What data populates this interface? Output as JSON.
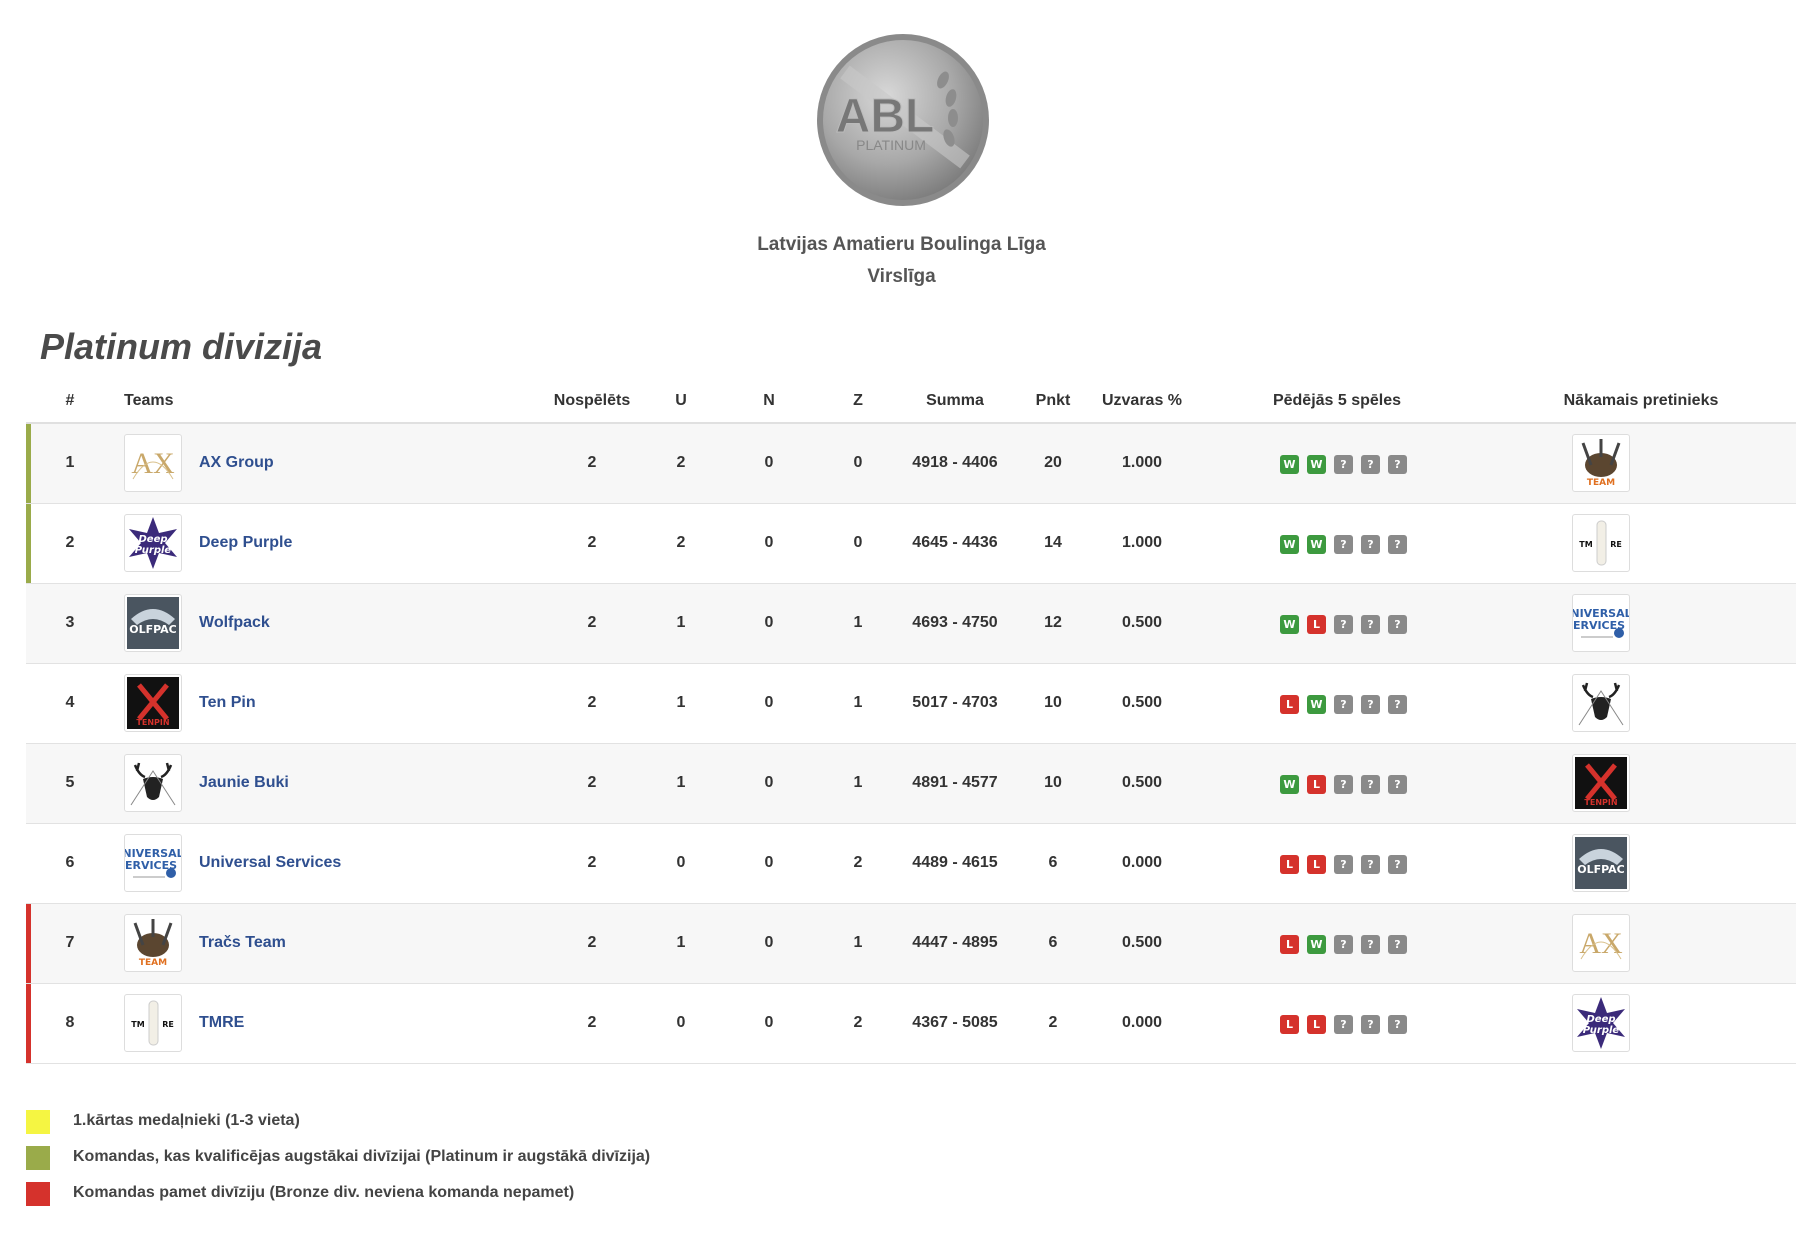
{
  "header": {
    "logo_text": "ABL",
    "logo_subtext": "PLATINUM",
    "league_name": "Latvijas Amatieru Boulinga Līga",
    "league_sub": "Virslīga"
  },
  "section_title": "Platinum divizija",
  "columns": {
    "rank": "#",
    "teams": "Teams",
    "played": "Nospēlēts",
    "wins": "U",
    "draws": "N",
    "losses": "Z",
    "total": "Summa",
    "points": "Pnkt",
    "win_pct": "Uzvaras %",
    "last5": "Pēdējās 5 spēles",
    "next": "Nākamais pretinieks"
  },
  "rows": [
    {
      "rank": "1",
      "team": "AX Group",
      "played": "2",
      "wins": "2",
      "draws": "0",
      "losses": "0",
      "total": "4918 - 4406",
      "points": "20",
      "pct": "1.000",
      "form": [
        "W",
        "W",
        "?",
        "?",
        "?"
      ],
      "logo": "ax-logo",
      "next": "tracs-logo",
      "marker": "#9aab4a"
    },
    {
      "rank": "2",
      "team": "Deep Purple",
      "played": "2",
      "wins": "2",
      "draws": "0",
      "losses": "0",
      "total": "4645 - 4436",
      "points": "14",
      "pct": "1.000",
      "form": [
        "W",
        "W",
        "?",
        "?",
        "?"
      ],
      "logo": "deep-purple-logo",
      "next": "tmre-logo",
      "marker": "#9aab4a"
    },
    {
      "rank": "3",
      "team": "Wolfpack",
      "played": "2",
      "wins": "1",
      "draws": "0",
      "losses": "1",
      "total": "4693 - 4750",
      "points": "12",
      "pct": "0.500",
      "form": [
        "W",
        "L",
        "?",
        "?",
        "?"
      ],
      "logo": "wolfpack-logo",
      "next": "universal-logo",
      "marker": ""
    },
    {
      "rank": "4",
      "team": "Ten Pin",
      "played": "2",
      "wins": "1",
      "draws": "0",
      "losses": "1",
      "total": "5017 - 4703",
      "points": "10",
      "pct": "0.500",
      "form": [
        "L",
        "W",
        "?",
        "?",
        "?"
      ],
      "logo": "tenpin-logo",
      "next": "buki-logo",
      "marker": ""
    },
    {
      "rank": "5",
      "team": "Jaunie Buki",
      "played": "2",
      "wins": "1",
      "draws": "0",
      "losses": "1",
      "total": "4891 - 4577",
      "points": "10",
      "pct": "0.500",
      "form": [
        "W",
        "L",
        "?",
        "?",
        "?"
      ],
      "logo": "buki-logo",
      "next": "tenpin-logo",
      "marker": ""
    },
    {
      "rank": "6",
      "team": "Universal Services",
      "played": "2",
      "wins": "0",
      "draws": "0",
      "losses": "2",
      "total": "4489 - 4615",
      "points": "6",
      "pct": "0.000",
      "form": [
        "L",
        "L",
        "?",
        "?",
        "?"
      ],
      "logo": "universal-logo",
      "next": "wolfpack-logo",
      "marker": ""
    },
    {
      "rank": "7",
      "team": "Tračs Team",
      "played": "2",
      "wins": "1",
      "draws": "0",
      "losses": "1",
      "total": "4447 - 4895",
      "points": "6",
      "pct": "0.500",
      "form": [
        "L",
        "W",
        "?",
        "?",
        "?"
      ],
      "logo": "tracs-logo",
      "next": "ax-logo",
      "marker": "#d5322c"
    },
    {
      "rank": "8",
      "team": "TMRE",
      "played": "2",
      "wins": "0",
      "draws": "0",
      "losses": "2",
      "total": "4367 - 5085",
      "points": "2",
      "pct": "0.000",
      "form": [
        "L",
        "L",
        "?",
        "?",
        "?"
      ],
      "logo": "tmre-logo",
      "next": "deep-purple-logo",
      "marker": "#d5322c"
    }
  ],
  "legend": [
    {
      "color": "#f5f542",
      "text": "1.kārtas medaļnieki (1-3 vieta)"
    },
    {
      "color": "#9aab4a",
      "text": "Komandas, kas kvalificējas augstākai divīzijai (Platinum ir augstākā divīzija)"
    },
    {
      "color": "#d5322c",
      "text": "Komandas pamet divīziju (Bronze div. neviena komanda nepamet)"
    }
  ]
}
